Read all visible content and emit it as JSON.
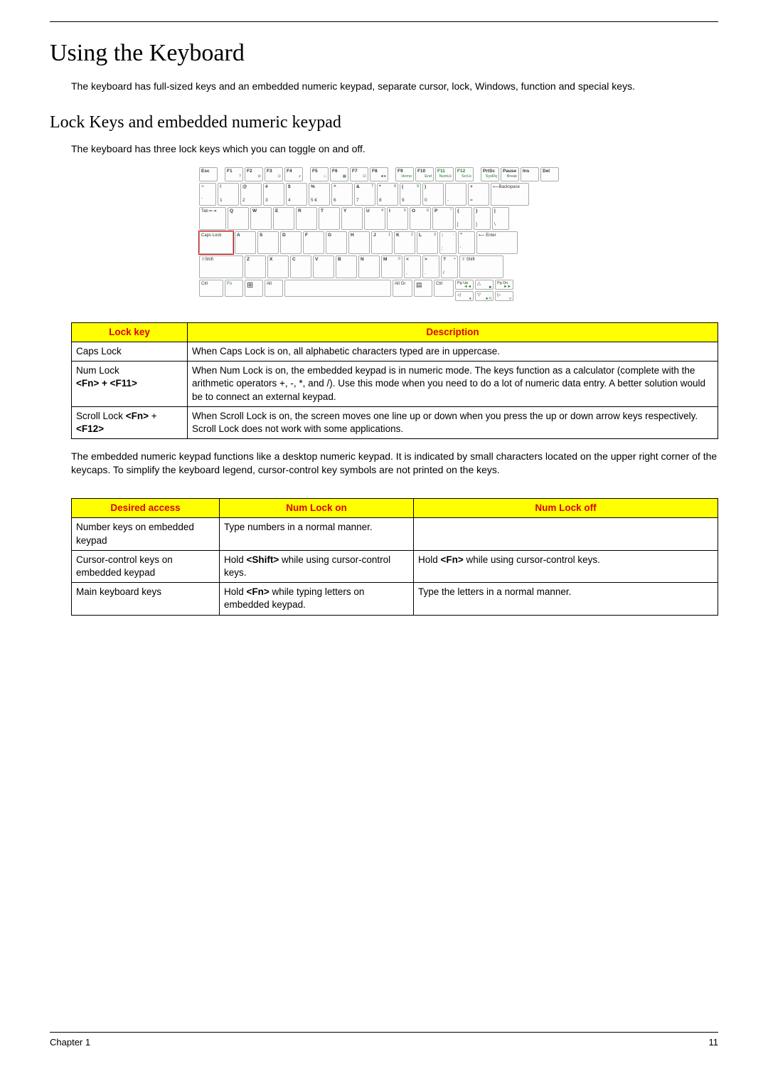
{
  "heading": "Using the Keyboard",
  "intro": "The keyboard has full-sized keys and an embedded numeric keypad, separate cursor, lock, Windows, function and special keys.",
  "subheading": "Lock Keys and embedded numeric keypad",
  "sub_intro": "The keyboard has three lock keys which you can toggle on and off.",
  "table1": {
    "headers": [
      "Lock key",
      "Description"
    ],
    "rows": [
      {
        "key": "Caps Lock",
        "keyHtml": "Caps Lock",
        "desc": "When Caps Lock is on, all alphabetic characters typed are in uppercase."
      },
      {
        "key": "Num Lock <Fn> + <F11>",
        "keyHtml": "Num Lock<br><span class=\"b\">&lt;Fn&gt; + &lt;F11&gt;</span>",
        "desc": "When Num Lock is on, the embedded keypad is in numeric mode. The keys function as a calculator (complete with the arithmetic operators +, -, *, and /). Use this mode when you need to do a lot of numeric data entry. A better solution would be to connect an external keypad."
      },
      {
        "key": "Scroll Lock <Fn> + <F12>",
        "keyHtml": "Scroll Lock <span class=\"b\">&lt;Fn&gt;</span> + <span class=\"b\">&lt;F12&gt;</span>",
        "desc": "When Scroll Lock is on, the screen moves one line up or down when you press the up or down arrow keys respectively. Scroll Lock does not work with some applications."
      }
    ]
  },
  "mid_para": "The embedded numeric keypad functions like a desktop numeric keypad. It is indicated by small characters located on the upper right corner of the keycaps. To simplify the keyboard legend, cursor-control key symbols are not printed on the keys.",
  "table2": {
    "headers": [
      "Desired access",
      "Num Lock on",
      "Num Lock off"
    ],
    "rows": [
      {
        "c1": "Number keys on embedded keypad",
        "c2": "Type numbers in a normal manner.",
        "c3": ""
      },
      {
        "c1": "Cursor-control keys on embedded keypad",
        "c2": "Hold <span class=\"b\">&lt;Shift&gt;</span> while using cursor-control keys.",
        "c3": "Hold <span class=\"b\">&lt;Fn&gt;</span> while using cursor-control keys."
      },
      {
        "c1": "Main keyboard keys",
        "c2": "Hold <span class=\"b\">&lt;Fn&gt;</span> while typing letters on embedded keypad.",
        "c3": "Type the letters in a normal manner."
      }
    ]
  },
  "footer_left": "Chapter 1",
  "footer_right": "11",
  "keyboard": {
    "row_f": [
      "Esc",
      "F1",
      "F2",
      "F3",
      "F4",
      "F5",
      "F6",
      "F7",
      "F8",
      "F9",
      "F10",
      "F11",
      "F12",
      "PrtSc",
      "Pause",
      "Ins",
      "Del"
    ],
    "row_f_sub": [
      "",
      "?",
      "⊘",
      "⊙",
      "z",
      "□",
      "▦",
      "☑",
      "◄●",
      "Home",
      "End",
      "NumLk",
      "ScrLk",
      "SysRq",
      "Break",
      "",
      ""
    ],
    "row_1_top": [
      "~",
      "!",
      "@",
      "#",
      "$",
      "%",
      "^",
      "&",
      "*",
      "(",
      ")",
      "",
      "+"
    ],
    "row_1_bot": [
      "`",
      "1",
      "2",
      "3",
      "4",
      "5 €",
      "6",
      "7",
      "8",
      "9",
      "0",
      "-",
      "="
    ],
    "row_1_sec": [
      "",
      "",
      "",
      "",
      "",
      "",
      "",
      "7",
      "8",
      "9",
      "",
      "",
      ""
    ],
    "backspace": "⟵Backspace",
    "row_q": [
      "Q",
      "W",
      "E",
      "R",
      "T",
      "Y",
      "U",
      "I",
      "O",
      "P"
    ],
    "row_q_sec": [
      "",
      "",
      "",
      "",
      "",
      "",
      "4",
      "5",
      "6",
      "*"
    ],
    "tab": "Tab ⇤⇥",
    "br_open_top": "{",
    "br_open_bot": "[",
    "br_close_top": "}",
    "br_close_bot": "]",
    "bslash_top": "|",
    "bslash_bot": "\\",
    "capslock": "Caps Lock",
    "row_a": [
      "A",
      "S",
      "D",
      "F",
      "G",
      "H",
      "J",
      "K",
      "L"
    ],
    "row_a_sec": [
      "",
      "",
      "",
      "",
      "",
      "",
      "1",
      "2",
      "3"
    ],
    "semi_top": ":",
    "semi_bot": ";",
    "semi_sec": "-",
    "quote_top": "\"",
    "quote_bot": "'",
    "enter": "⟵ Enter",
    "shift_l": "⇧Shift",
    "shift_r": "⇧ Shift",
    "row_z": [
      "Z",
      "X",
      "C",
      "V",
      "B",
      "N",
      "M"
    ],
    "row_z_sec": [
      "",
      "",
      "",
      "",
      "",
      "",
      "0"
    ],
    "lt_top": "<",
    "lt_bot": ",",
    "gt_top": ">",
    "gt_bot": ".",
    "gt_sec": "·",
    "qm_top": "?",
    "qm_bot": "/",
    "qm_sec": "+",
    "ctrl": "Ctrl",
    "fn": "Fn",
    "win": "⊞",
    "alt": "Alt",
    "altgr": "Alt Gr",
    "menu": "▤",
    "pgup": "Pg Up",
    "pgdn": "Pg Dn",
    "up": "△",
    "dn": "▽",
    "lf": "◁",
    "rt": "▷"
  }
}
